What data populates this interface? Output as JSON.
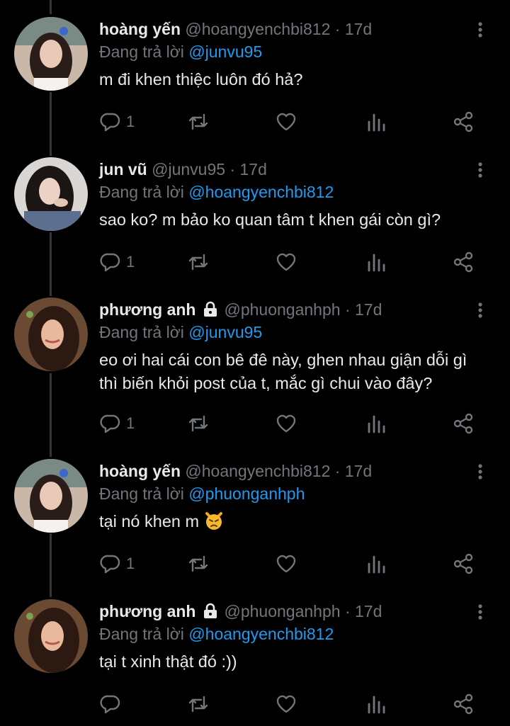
{
  "reply_prefix": "Đang trả lời",
  "tweets": [
    {
      "name": "hoàng yến",
      "handle": "@hoangyenchbi812",
      "separator": "·",
      "time": "17d",
      "reply_to": "@junvu95",
      "text": "m đi khen thiệc luôn đó hả?",
      "reply_count": "1",
      "locked": false
    },
    {
      "name": "jun vũ",
      "handle": "@junvu95",
      "separator": "·",
      "time": "17d",
      "reply_to": "@hoangyenchbi812",
      "text": "sao ko? m bảo ko quan tâm t khen gái còn gì?",
      "reply_count": "1",
      "locked": false
    },
    {
      "name": "phương anh",
      "handle": "@phuonganhph",
      "separator": "·",
      "time": "17d",
      "reply_to": "@junvu95",
      "text": "eo ơi hai cái con bê đê này, ghen nhau giận dỗi gì thì biến khỏi post của t, mắc gì chui vào đây?",
      "reply_count": "1",
      "locked": true
    },
    {
      "name": "hoàng yến",
      "handle": "@hoangyenchbi812",
      "separator": "·",
      "time": "17d",
      "reply_to": "@phuonganhph",
      "text": "tại nó khen m",
      "emoji": "pouting-cat-emoji",
      "reply_count": "1",
      "locked": false
    },
    {
      "name": "phương anh",
      "handle": "@phuonganhph",
      "separator": "·",
      "time": "17d",
      "reply_to": "@hoangyenchbi812",
      "text": "tại t xinh thật đó :))",
      "reply_count": "",
      "locked": true
    }
  ],
  "icons": {
    "more": "more-vertical-icon",
    "reply": "reply-bubble-icon",
    "retweet": "retweet-icon",
    "like": "heart-icon",
    "views": "analytics-bars-icon",
    "share": "share-icon",
    "lock": "lock-icon"
  },
  "colors": {
    "background": "#000000",
    "text": "#e7e9ea",
    "muted": "#71767b",
    "mention": "#1d9bf0",
    "thread_line": "#333639"
  }
}
